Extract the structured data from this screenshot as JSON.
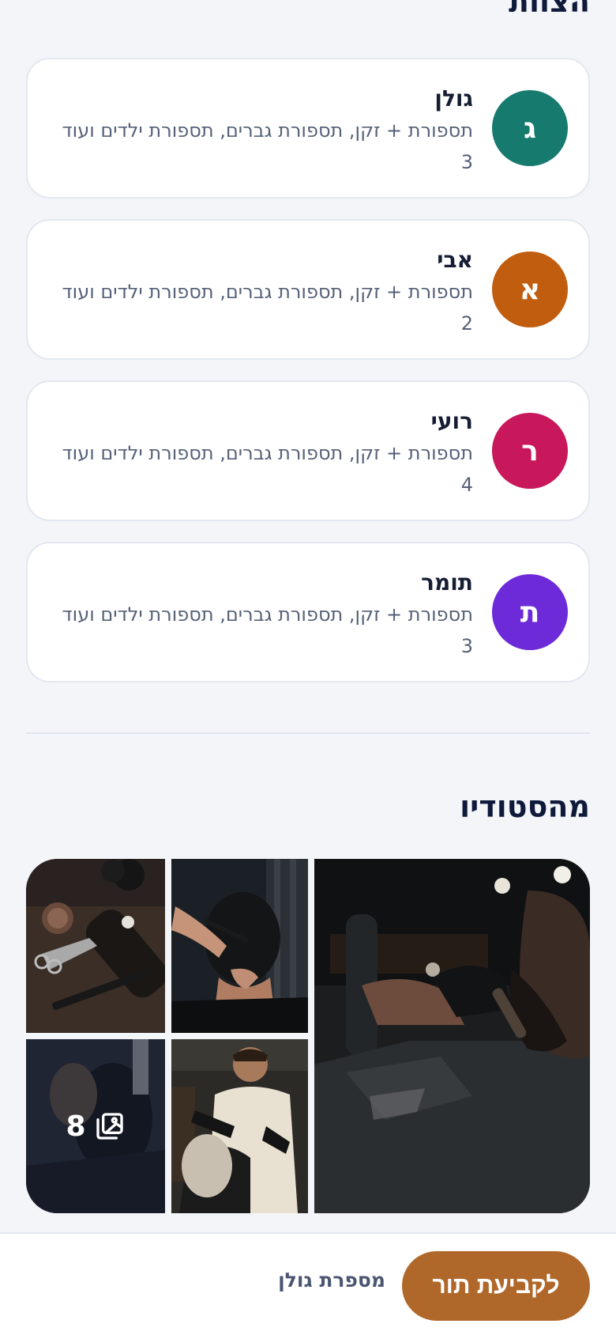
{
  "team": {
    "title": "הצוות",
    "members": [
      {
        "initial": "ג",
        "name": "גולן",
        "services": "תספורת + זקן, תספורת גברים, תספורת ילדים ועוד",
        "count": "3",
        "color": "#177a6e"
      },
      {
        "initial": "א",
        "name": "אבי",
        "services": "תספורת + זקן, תספורת גברים, תספורת ילדים ועוד",
        "count": "2",
        "color": "#c15d0e"
      },
      {
        "initial": "ר",
        "name": "רועי",
        "services": "תספורת + זקן, תספורת גברים, תספורת ילדים ועוד",
        "count": "4",
        "color": "#c8175a"
      },
      {
        "initial": "ת",
        "name": "תומר",
        "services": "תספורת + זקן, תספורת גברים, תספורת ילדים ועוד",
        "count": "3",
        "color": "#6d2ad8"
      }
    ]
  },
  "studio": {
    "title": "מהסטודיו",
    "more_count": "8",
    "icons": {
      "more": "gallery-icon"
    }
  },
  "bottom_bar": {
    "brand": "מספרת גולן",
    "cta_label": "לקביעת תור",
    "cta_color": "#b0682a"
  }
}
